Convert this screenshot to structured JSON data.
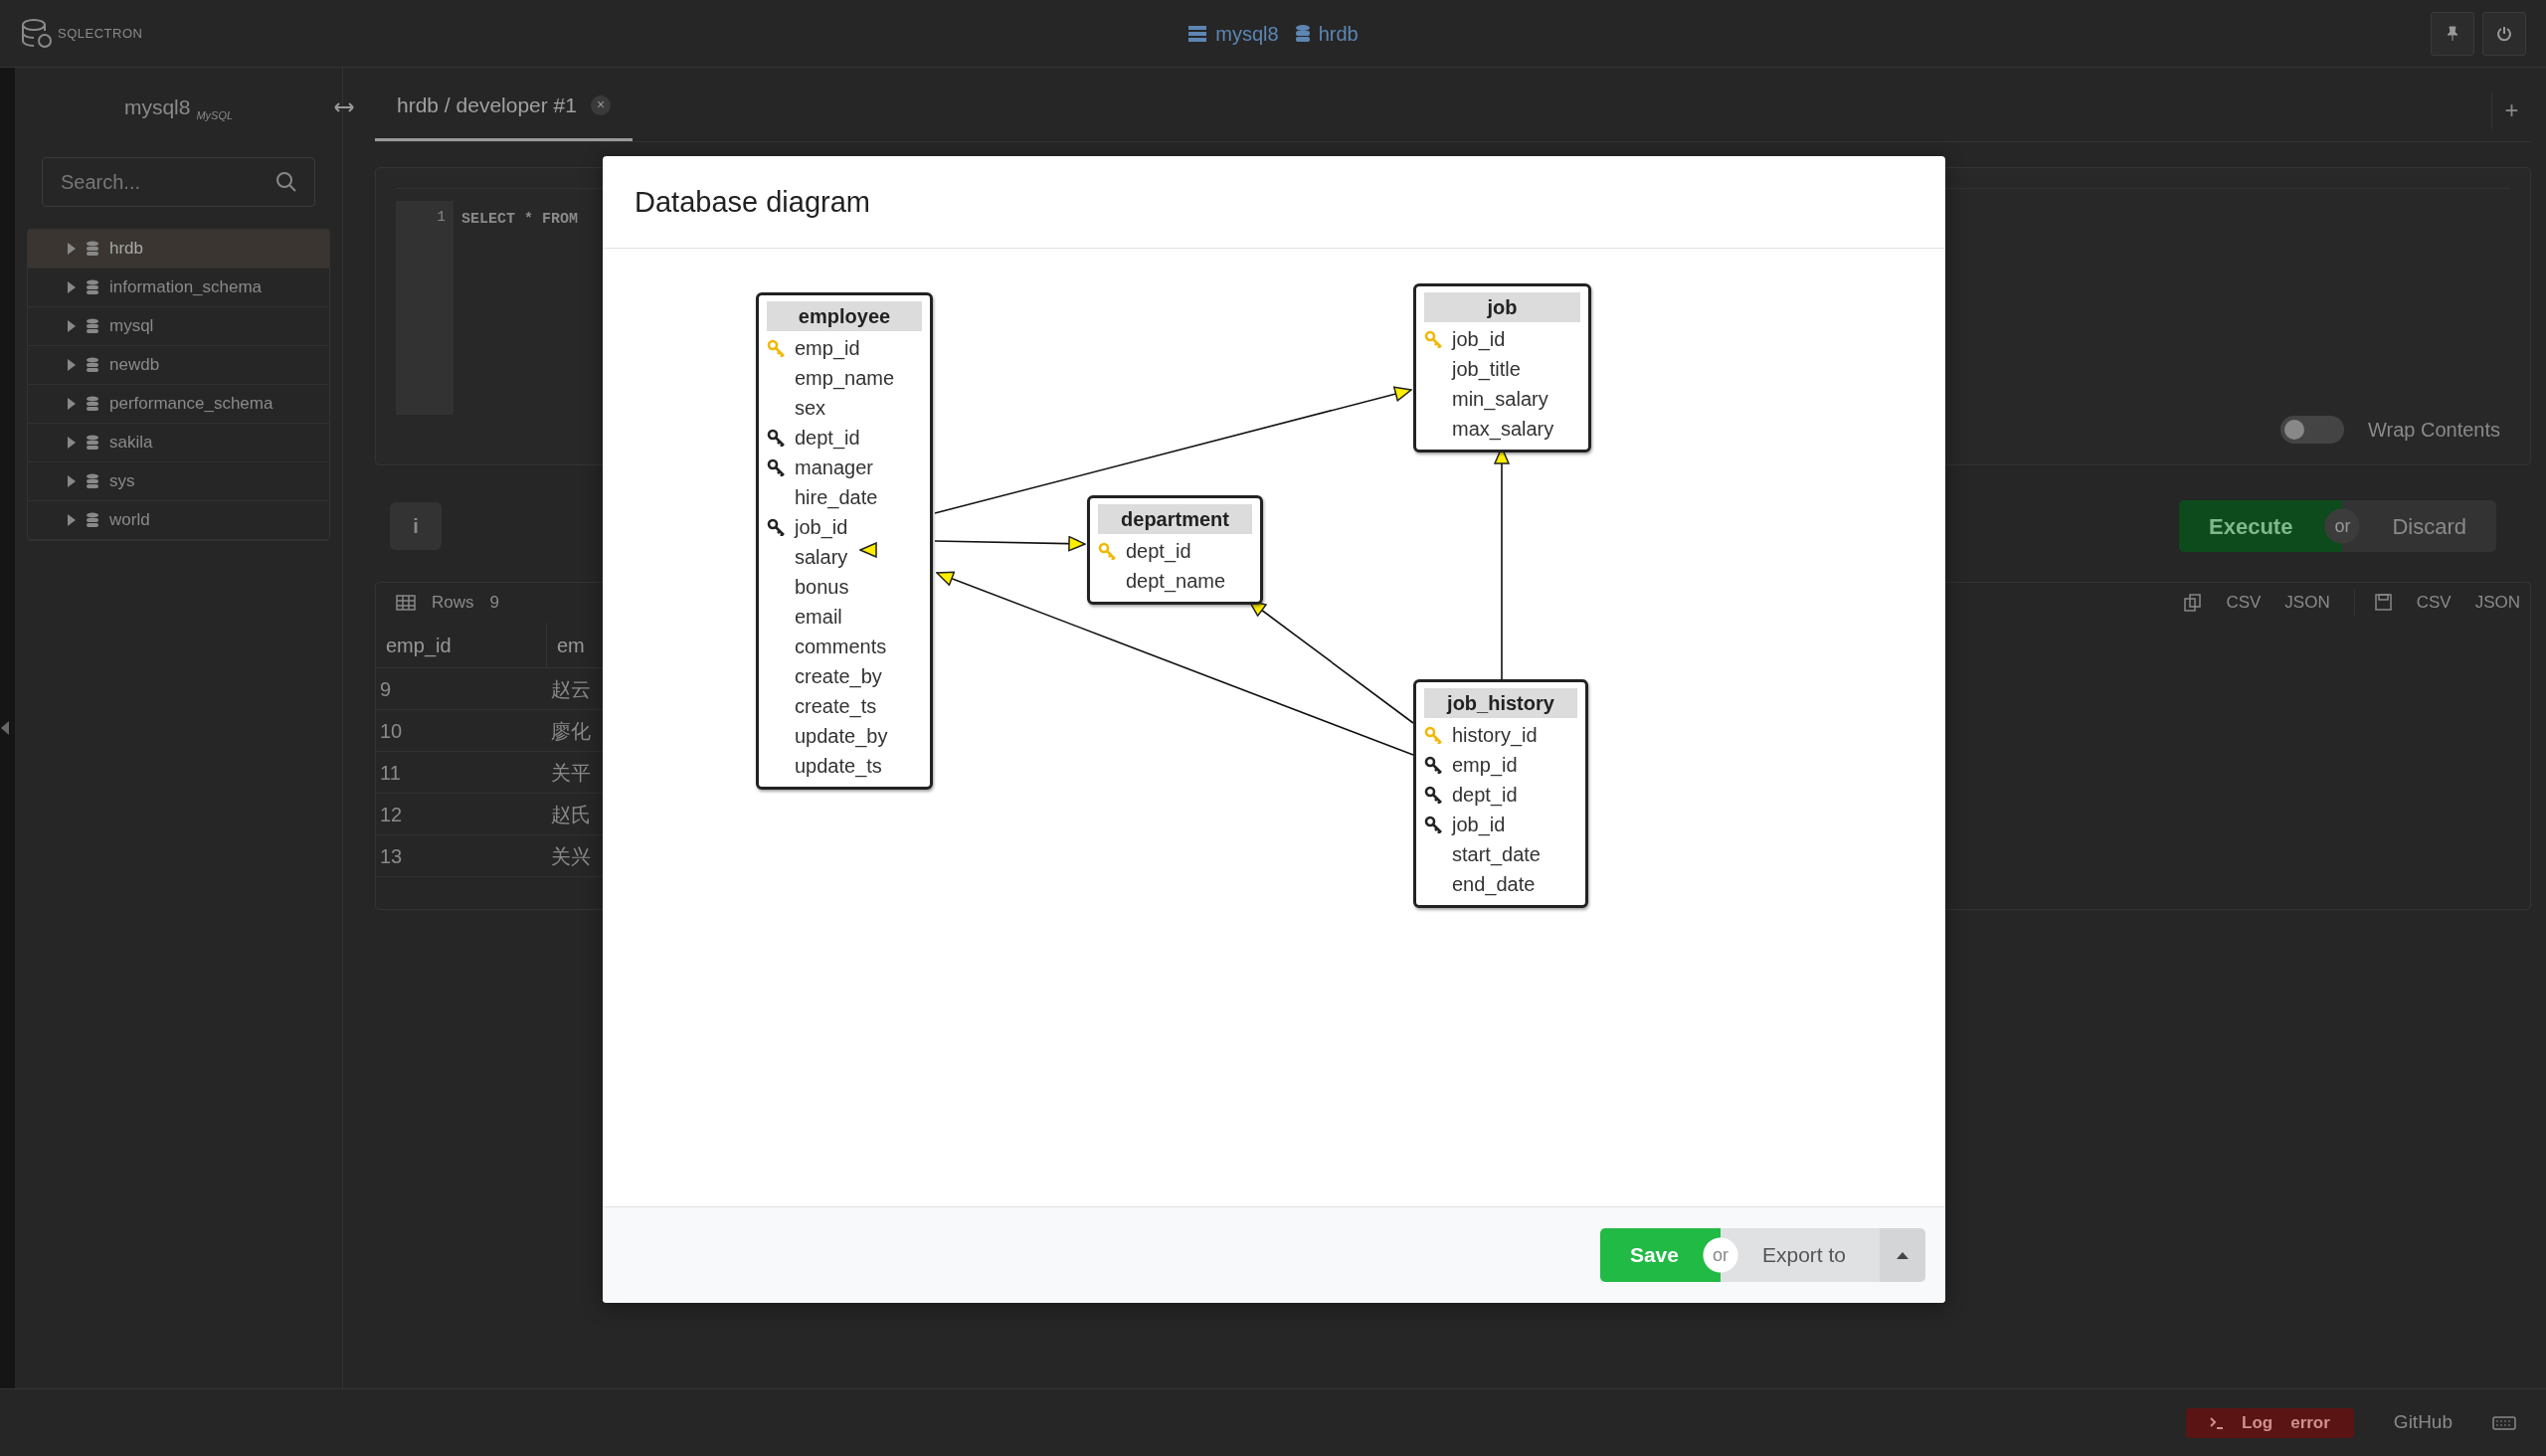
{
  "app": {
    "logo": "SQLECTRON",
    "connection": "mysql8",
    "database": "hrdb"
  },
  "sidebar": {
    "server": "mysql8",
    "server_badge": "MySQL",
    "search": {
      "placeholder": "Search..."
    },
    "databases": [
      {
        "name": "hrdb",
        "selected": true
      },
      {
        "name": "information_schema",
        "selected": false
      },
      {
        "name": "mysql",
        "selected": false
      },
      {
        "name": "newdb",
        "selected": false
      },
      {
        "name": "performance_schema",
        "selected": false
      },
      {
        "name": "sakila",
        "selected": false
      },
      {
        "name": "sys",
        "selected": false
      },
      {
        "name": "world",
        "selected": false
      }
    ]
  },
  "tabs": [
    {
      "label": "hrdb / developer #1",
      "selected": true,
      "close": "×"
    }
  ],
  "add_tab": "+",
  "editor": {
    "line_numbers": [
      "1"
    ],
    "query": "SELECT * FROM",
    "wrap_label": "Wrap Contents",
    "wrap_on": false
  },
  "info_button": "i",
  "actions": {
    "execute": "Execute",
    "or": "or",
    "discard": "Discard"
  },
  "results": {
    "tab": "Rows",
    "count": "9",
    "copy": [
      "CSV",
      "JSON"
    ],
    "save": [
      "CSV",
      "JSON"
    ],
    "columns": [
      "emp_id",
      "em"
    ],
    "rows": [
      [
        "9",
        "赵云"
      ],
      [
        "10",
        "廖化"
      ],
      [
        "11",
        "关平"
      ],
      [
        "12",
        "赵氏"
      ],
      [
        "13",
        "关兴"
      ]
    ]
  },
  "modal": {
    "title": "Database diagram",
    "tables": [
      {
        "name": "employee",
        "columns": [
          {
            "name": "emp_id",
            "kind": "primary"
          },
          {
            "name": "emp_name",
            "kind": "plain"
          },
          {
            "name": "sex",
            "kind": "plain"
          },
          {
            "name": "dept_id",
            "kind": "foreign"
          },
          {
            "name": "manager",
            "kind": "foreign"
          },
          {
            "name": "hire_date",
            "kind": "plain"
          },
          {
            "name": "job_id",
            "kind": "foreign"
          },
          {
            "name": "salary",
            "kind": "plain"
          },
          {
            "name": "bonus",
            "kind": "plain"
          },
          {
            "name": "email",
            "kind": "plain"
          },
          {
            "name": "comments",
            "kind": "plain"
          },
          {
            "name": "create_by",
            "kind": "plain"
          },
          {
            "name": "create_ts",
            "kind": "plain"
          },
          {
            "name": "update_by",
            "kind": "plain"
          },
          {
            "name": "update_ts",
            "kind": "plain"
          }
        ]
      },
      {
        "name": "job",
        "columns": [
          {
            "name": "job_id",
            "kind": "primary"
          },
          {
            "name": "job_title",
            "kind": "plain"
          },
          {
            "name": "min_salary",
            "kind": "plain"
          },
          {
            "name": "max_salary",
            "kind": "plain"
          }
        ]
      },
      {
        "name": "department",
        "columns": [
          {
            "name": "dept_id",
            "kind": "primary"
          },
          {
            "name": "dept_name",
            "kind": "plain"
          }
        ]
      },
      {
        "name": "job_history",
        "columns": [
          {
            "name": "history_id",
            "kind": "primary"
          },
          {
            "name": "emp_id",
            "kind": "foreign"
          },
          {
            "name": "dept_id",
            "kind": "foreign"
          },
          {
            "name": "job_id",
            "kind": "foreign"
          },
          {
            "name": "start_date",
            "kind": "plain"
          },
          {
            "name": "end_date",
            "kind": "plain"
          }
        ]
      }
    ],
    "footer": {
      "save": "Save",
      "or": "or",
      "export": "Export to"
    }
  },
  "status_bar": {
    "log": "Log",
    "error": "error",
    "github": "GitHub"
  }
}
